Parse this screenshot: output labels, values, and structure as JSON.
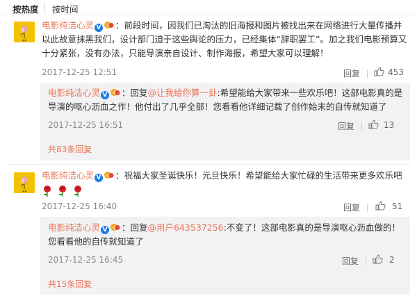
{
  "tabs": [
    {
      "label": "按热度",
      "active": true
    },
    {
      "label": "按时间",
      "active": false
    }
  ],
  "comments": [
    {
      "user": "电影纯洁心灵",
      "colon": "：",
      "text": "前段时间，因我们已淘汰的旧海报和图片被找出来在网络进行大量传播并以此故意抹黑我们，设计部门迫于这些舆论的压力，已经集体“辞职罢工”。加之我们电影预算又十分紧张，没有办法，只能导演亲自设计、制作海报，希望大家可以理解！",
      "time": "2017-12-25 12:51",
      "reply_label": "回复",
      "likes": "453",
      "reply": {
        "user": "电影纯洁心灵",
        "prefix": "：回复",
        "mention": "@让我给你算一卦",
        "text": ":希望能给大家带来一些欢乐吧！这部电影真的是导演的呕心沥血之作！他付出了几乎全部！您看看他详细记载了创作始末的自传就知道了",
        "time": "2017-12-25 16:51",
        "reply_label": "回复",
        "likes": "13"
      },
      "more_replies": "共83条回复"
    },
    {
      "user": "电影纯洁心灵",
      "colon": "：",
      "text": "祝福大家圣诞快乐！元旦快乐！希望能给大家忙碌的生活带来更多欢乐吧",
      "time": "2017-12-25 16:40",
      "reply_label": "回复",
      "likes": "51",
      "reply": {
        "user": "电影纯洁心灵",
        "prefix": "：回复",
        "mention": "@用户643537256",
        "text": ":不变了！这部电影真的是导演呕心沥血做的！您看看他的自传就知道了",
        "time": "2017-12-25 16:45",
        "reply_label": "回复",
        "likes": "2"
      },
      "more_replies": "共15条回复"
    }
  ],
  "colors": {
    "username": "#eb7350",
    "avatar_bg": "#f2c200",
    "reply_bg": "#f2f2f5",
    "verified": "#1c7ce3"
  },
  "icons": [
    "flower-avatar-icon",
    "verified-v-icon",
    "vip-crown-icon",
    "thumbs-up-icon",
    "rose-emoji-icon"
  ]
}
